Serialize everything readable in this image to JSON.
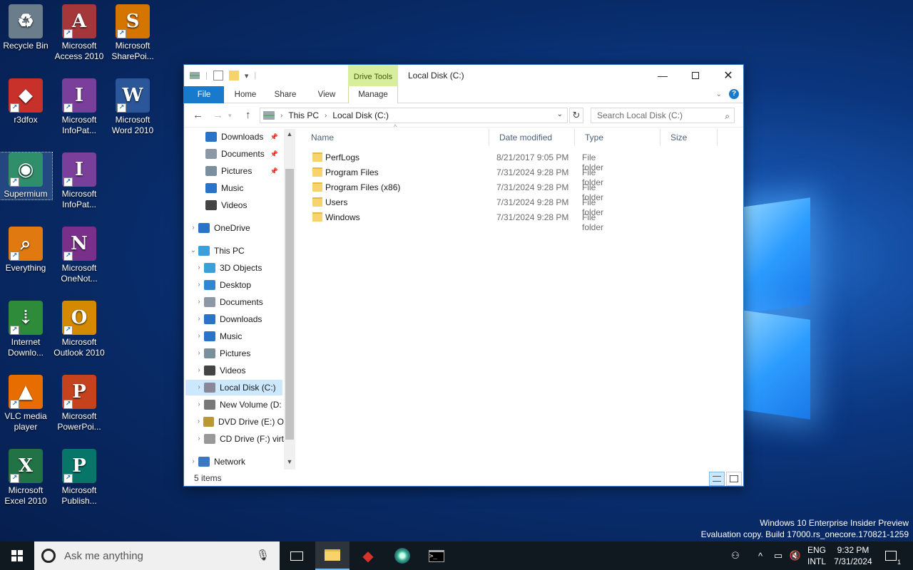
{
  "desktop": {
    "icons": [
      {
        "label": "Recycle Bin",
        "glyph": "♻",
        "color": "#6b7d8a"
      },
      {
        "label": "Microsoft Access 2010",
        "glyph": "A",
        "color": "#a4373a"
      },
      {
        "label": "Microsoft SharePoi...",
        "glyph": "S",
        "color": "#d47500"
      },
      {
        "label": "r3dfox",
        "glyph": "◆",
        "color": "#c8302a"
      },
      {
        "label": "Microsoft InfoPat...",
        "glyph": "I",
        "color": "#7a3f9a"
      },
      {
        "label": "Microsoft Word 2010",
        "glyph": "W",
        "color": "#2b579a"
      },
      {
        "label": "Supermium",
        "glyph": "◉",
        "color": "#2f8f6a"
      },
      {
        "label": "Microsoft InfoPat...",
        "glyph": "I",
        "color": "#7a3f9a"
      },
      {
        "label": "Everything",
        "glyph": "⌕",
        "color": "#e07a10"
      },
      {
        "label": "Microsoft OneNot...",
        "glyph": "N",
        "color": "#7a2f8a"
      },
      {
        "label": "Internet Downlo...",
        "glyph": "⇣",
        "color": "#2e8b3a"
      },
      {
        "label": "Microsoft Outlook 2010",
        "glyph": "O",
        "color": "#d48a00"
      },
      {
        "label": "VLC media player",
        "glyph": "▲",
        "color": "#e86d00"
      },
      {
        "label": "Microsoft PowerPoi...",
        "glyph": "P",
        "color": "#c4421e"
      },
      {
        "label": "Microsoft Excel 2010",
        "glyph": "X",
        "color": "#217346"
      },
      {
        "label": "Microsoft Publish...",
        "glyph": "P",
        "color": "#077568"
      }
    ]
  },
  "window": {
    "title": "Local Disk (C:)",
    "drive_tools": "Drive Tools",
    "tabs": {
      "file": "File",
      "home": "Home",
      "share": "Share",
      "view": "View",
      "manage": "Manage"
    },
    "address": {
      "crumb1": "This PC",
      "crumb2": "Local Disk (C:)"
    },
    "search_placeholder": "Search Local Disk (C:)",
    "nav": {
      "quick": [
        {
          "label": "Downloads",
          "pinned": true
        },
        {
          "label": "Documents",
          "pinned": true
        },
        {
          "label": "Pictures",
          "pinned": true
        },
        {
          "label": "Music"
        },
        {
          "label": "Videos"
        }
      ],
      "onedrive": "OneDrive",
      "thispc": "This PC",
      "pc_children": [
        "3D Objects",
        "Desktop",
        "Documents",
        "Downloads",
        "Music",
        "Pictures",
        "Videos",
        "Local Disk (C:)",
        "New Volume (D:",
        "DVD Drive (E:) O",
        "CD Drive (F:) virt"
      ],
      "network": "Network"
    },
    "columns": {
      "name": "Name",
      "date": "Date modified",
      "type": "Type",
      "size": "Size"
    },
    "files": [
      {
        "name": "PerfLogs",
        "date": "8/21/2017 9:05 PM",
        "type": "File folder"
      },
      {
        "name": "Program Files",
        "date": "7/31/2024 9:28 PM",
        "type": "File folder"
      },
      {
        "name": "Program Files (x86)",
        "date": "7/31/2024 9:28 PM",
        "type": "File folder"
      },
      {
        "name": "Users",
        "date": "7/31/2024 9:28 PM",
        "type": "File folder"
      },
      {
        "name": "Windows",
        "date": "7/31/2024 9:28 PM",
        "type": "File folder"
      }
    ],
    "status": "5 items"
  },
  "watermark": {
    "line1": "Windows 10 Enterprise Insider Preview",
    "line2": "Evaluation copy. Build 17000.rs_onecore.170821-1259"
  },
  "taskbar": {
    "search_placeholder": "Ask me anything",
    "lang1": "ENG",
    "lang2": "INTL",
    "time": "9:32 PM",
    "date": "7/31/2024",
    "notification_count": "1"
  }
}
